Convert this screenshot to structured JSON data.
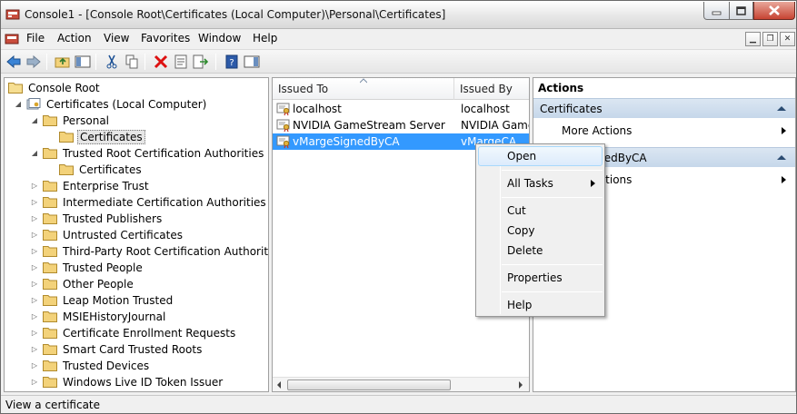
{
  "window": {
    "title": "Console1 - [Console Root\\Certificates (Local Computer)\\Personal\\Certificates]"
  },
  "menu": [
    "File",
    "Action",
    "View",
    "Favorites",
    "Window",
    "Help"
  ],
  "tree": [
    {
      "label": "Console Root",
      "depth": 0,
      "expander": "none"
    },
    {
      "label": "Certificates (Local Computer)",
      "depth": 1,
      "expander": "expanded"
    },
    {
      "label": "Personal",
      "depth": 2,
      "expander": "expanded"
    },
    {
      "label": "Certificates",
      "depth": 3,
      "expander": "none",
      "selected": true
    },
    {
      "label": "Trusted Root Certification Authorities",
      "depth": 2,
      "expander": "expanded"
    },
    {
      "label": "Certificates",
      "depth": 3,
      "expander": "none"
    },
    {
      "label": "Enterprise Trust",
      "depth": 2,
      "expander": "collapsed"
    },
    {
      "label": "Intermediate Certification Authorities",
      "depth": 2,
      "expander": "collapsed"
    },
    {
      "label": "Trusted Publishers",
      "depth": 2,
      "expander": "collapsed"
    },
    {
      "label": "Untrusted Certificates",
      "depth": 2,
      "expander": "collapsed"
    },
    {
      "label": "Third-Party Root Certification Authorities",
      "depth": 2,
      "expander": "collapsed"
    },
    {
      "label": "Trusted People",
      "depth": 2,
      "expander": "collapsed"
    },
    {
      "label": "Other People",
      "depth": 2,
      "expander": "collapsed"
    },
    {
      "label": "Leap Motion Trusted",
      "depth": 2,
      "expander": "collapsed"
    },
    {
      "label": "MSIEHistoryJournal",
      "depth": 2,
      "expander": "collapsed"
    },
    {
      "label": "Certificate Enrollment Requests",
      "depth": 2,
      "expander": "collapsed"
    },
    {
      "label": "Smart Card Trusted Roots",
      "depth": 2,
      "expander": "collapsed"
    },
    {
      "label": "Trusted Devices",
      "depth": 2,
      "expander": "collapsed"
    },
    {
      "label": "Windows Live ID Token Issuer",
      "depth": 2,
      "expander": "collapsed"
    }
  ],
  "list": {
    "columns": [
      "Issued To",
      "Issued By"
    ],
    "rows": [
      {
        "issued_to": "localhost",
        "issued_by": "localhost"
      },
      {
        "issued_to": "NVIDIA GameStream Server",
        "issued_by": "NVIDIA GameS"
      },
      {
        "issued_to": "vMargeSignedByCA",
        "issued_by": "vMargeCA",
        "selected": true
      }
    ]
  },
  "actions": {
    "header": "Actions",
    "sections": [
      {
        "title": "Certificates",
        "items": [
          "More Actions"
        ]
      },
      {
        "title": "vMargeSignedByCA",
        "items": [
          "More Actions"
        ]
      }
    ]
  },
  "context_menu": [
    "Open",
    "All Tasks",
    "Cut",
    "Copy",
    "Delete",
    "Properties",
    "Help"
  ],
  "status": "View a certificate",
  "colors": {
    "selection": "#3399ff",
    "action_header": "#c6d7ea",
    "folder": "#f3d27a"
  }
}
